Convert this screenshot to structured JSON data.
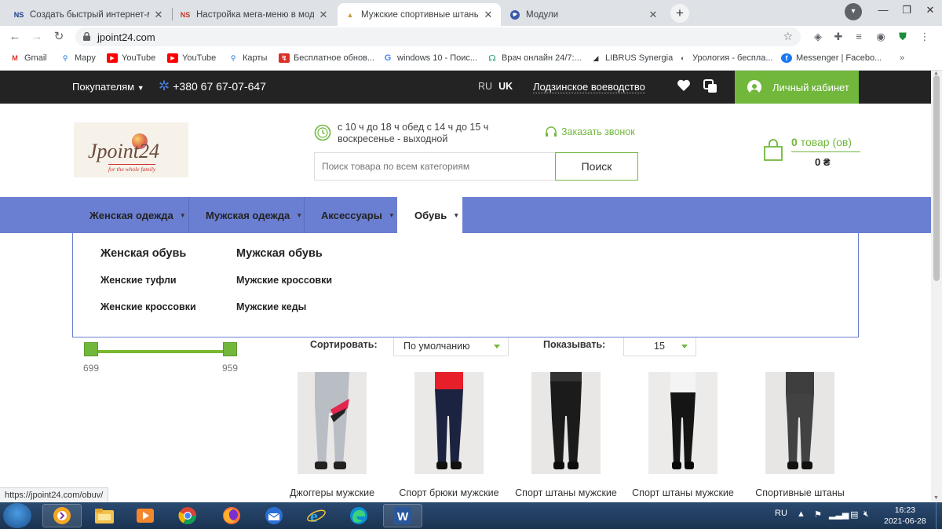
{
  "browser": {
    "tabs": [
      {
        "title": "Создать быстрый интернет-маг",
        "favicon": "NS",
        "active": false
      },
      {
        "title": "Настройка мега-меню в модуле",
        "favicon": "NS",
        "active": false
      },
      {
        "title": "Мужские спортивные штаны",
        "favicon": "logo",
        "active": true
      },
      {
        "title": "Модули",
        "favicon": "globe",
        "active": false
      }
    ],
    "url": "jpoint24.com",
    "bookmarks": [
      {
        "label": "Gmail",
        "icon": "gmail-icon",
        "color": "#d93025"
      },
      {
        "label": "Карты",
        "icon": "maps-pin-icon",
        "color": "#1a73e8"
      },
      {
        "label": "YouTube",
        "icon": "youtube-icon",
        "color": "#ff0000"
      },
      {
        "label": "YouTube",
        "icon": "youtube-icon",
        "color": "#ff0000"
      },
      {
        "label": "Карты",
        "icon": "maps-pin-icon",
        "color": "#1a73e8"
      },
      {
        "label": "Бесплатное обнов...",
        "icon": "update-icon",
        "color": "#d93025"
      },
      {
        "label": "windows 10 - Поис...",
        "icon": "google-icon",
        "color": "#4285f4"
      },
      {
        "label": "Врач онлайн 24/7:...",
        "icon": "doctor-icon",
        "color": "#1aa36b"
      },
      {
        "label": "LIBRUS Synergia",
        "icon": "librus-icon",
        "color": "#333333"
      },
      {
        "label": "Урология - беспла...",
        "icon": "urology-icon",
        "color": "#555555"
      },
      {
        "label": "Messenger | Facebo...",
        "icon": "facebook-icon",
        "color": "#1877f2"
      }
    ],
    "status_url": "https://jpoint24.com/obuv/"
  },
  "site": {
    "topbar": {
      "buyers": "Покупателям",
      "phone": "+380 67 67-07-647",
      "lang_ru": "RU",
      "lang_uk": "UK",
      "region": "Лодзинское воеводство",
      "cabinet": "Личный кабинет"
    },
    "logo": {
      "name": "Jpoint24",
      "tagline": "for the whole family"
    },
    "hours_line1": "с 10 ч до 18 ч обед с 14 ч до 15 ч",
    "hours_line2": "воскресенье - выходной",
    "callback": "Заказать звонок",
    "search": {
      "placeholder": "Поиск товара по всем категориям",
      "button": "Поиск"
    },
    "cart": {
      "count": "0",
      "count_label": "товар (ов)",
      "sum": "0 ₴"
    },
    "menu": [
      {
        "label": "Женская одежда",
        "active": false
      },
      {
        "label": "Мужская одежда",
        "active": false
      },
      {
        "label": "Аксессуары",
        "active": false
      },
      {
        "label": "Обувь",
        "active": true
      }
    ],
    "mega": {
      "columns": [
        {
          "heading": "Женская обувь",
          "links": [
            "Женские туфли",
            "Женские кроссовки"
          ]
        },
        {
          "heading": "Мужская обувь",
          "links": [
            "Мужские кроссовки",
            "Мужские кеды"
          ]
        }
      ]
    },
    "price_filter": {
      "min": "699",
      "max": "959"
    },
    "sort": {
      "label": "Сортировать:",
      "value": "По умолчанию"
    },
    "show": {
      "label": "Показывать:",
      "value": "15"
    },
    "products": [
      {
        "title": "Джоггеры мужские"
      },
      {
        "title": "Спорт брюки мужские"
      },
      {
        "title": "Спорт штаны мужские"
      },
      {
        "title": "Спорт штаны мужские"
      },
      {
        "title": "Спортивные штаны"
      }
    ]
  },
  "taskbar": {
    "lang": "RU",
    "time": "16:23",
    "date": "2021-06-28"
  },
  "colors": {
    "accent_green": "#71b73c",
    "menu_blue": "#6b7fd2",
    "topbar_dark": "#232323"
  }
}
